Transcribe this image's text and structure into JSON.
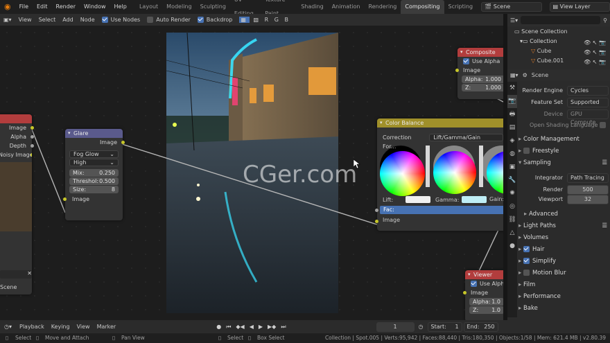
{
  "menu": [
    "File",
    "Edit",
    "Render",
    "Window",
    "Help"
  ],
  "workspaces": [
    "Layout",
    "Modeling",
    "Sculpting",
    "UV Editing",
    "Texture Paint",
    "Shading",
    "Animation",
    "Rendering",
    "Compositing",
    "Scripting"
  ],
  "active_workspace": "Compositing",
  "scene_field": "Scene",
  "view_layer_field": "View Layer",
  "node_header": {
    "view": "View",
    "select": "Select",
    "add": "Add",
    "node": "Node",
    "use_nodes": "Use Nodes",
    "auto_render": "Auto Render",
    "backdrop": "Backdrop",
    "channels": [
      "R",
      "G",
      "B"
    ]
  },
  "watermark": "CGer.com",
  "render_layers_node": {
    "outputs": [
      "Image",
      "Alpha",
      "Depth",
      "Noisy Image"
    ],
    "scene": "Scene"
  },
  "glare": {
    "title": "Glare",
    "output": "Image",
    "type": "Fog Glow",
    "quality": "High",
    "mix_label": "Mix:",
    "mix": "0.250",
    "threshold_label": "Threshol:",
    "threshold": "0.500",
    "size_label": "Size:",
    "size": "8",
    "input": "Image"
  },
  "color_balance": {
    "title": "Color Balance",
    "correction_label": "Correction For...",
    "correction": "Lift/Gamma/Gain",
    "wheels": [
      "Lift:",
      "Gamma:",
      "Gain:"
    ],
    "fac": "Fac:",
    "input": "Image"
  },
  "composite": {
    "title": "Composite",
    "use_alpha": "Use Alpha",
    "image": "Image",
    "alpha_label": "Alpha:",
    "alpha": "1.000",
    "z_label": "Z:",
    "z": "1.000"
  },
  "viewer": {
    "title": "Viewer",
    "use_alpha": "Use Alpha",
    "image": "Image",
    "alpha_label": "Alpha:",
    "alpha": "1.0",
    "z_label": "Z:",
    "z": "1.0"
  },
  "outliner": {
    "scene_collection": "Scene Collection",
    "collection": "Collection",
    "items": [
      "Cube",
      "Cube.001"
    ]
  },
  "properties": {
    "scene_label": "Scene",
    "render_engine_label": "Render Engine",
    "render_engine": "Cycles",
    "feature_set_label": "Feature Set",
    "feature_set": "Supported",
    "device_label": "Device",
    "device": "GPU Compute",
    "osl_label": "Open Shading Language",
    "sections_top": [
      "Color Management",
      "Freestyle",
      "Sampling"
    ],
    "integrator_label": "Integrator",
    "integrator": "Path Tracing",
    "render_label": "Render",
    "render_samples": "500",
    "viewport_label": "Viewport",
    "viewport_samples": "32",
    "advanced": "Advanced",
    "sections": [
      "Light Paths",
      "Volumes",
      "Hair",
      "Simplify",
      "Motion Blur",
      "Film",
      "Performance",
      "Bake"
    ]
  },
  "timeline": {
    "playback": "Playback",
    "keying": "Keying",
    "view": "View",
    "marker": "Marker",
    "frame": "1",
    "start_label": "Start:",
    "start": "1",
    "end_label": "End:",
    "end": "250"
  },
  "status": {
    "select": "Select",
    "move": "Move and Attach",
    "pan": "Pan View",
    "select2": "Select",
    "box": "Box Select",
    "stats": "Collection | Spot.005 | Verts:95,942 | Faces:88,440 | Tris:180,350 | Objects:1/58 | Mem: 621.4 MB | v2.80.39"
  },
  "colors": {
    "accent": "#4772b3",
    "composite_header": "#b23d3d",
    "filter_header": "#5a5a8c",
    "color_header": "#a0902a"
  }
}
